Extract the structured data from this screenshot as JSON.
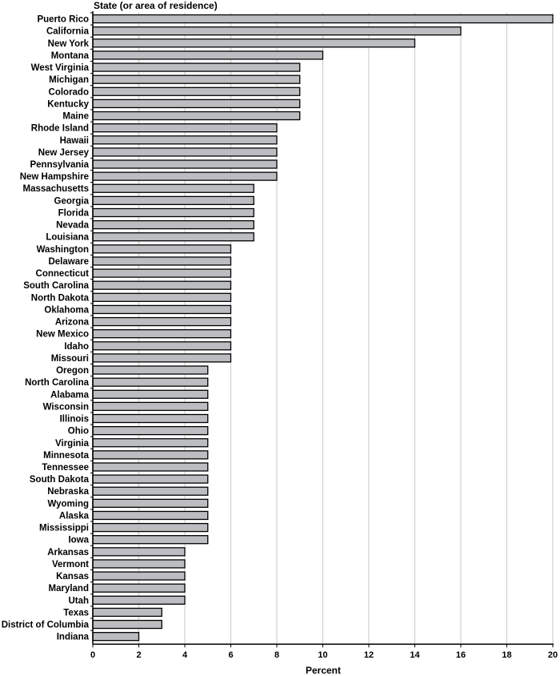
{
  "chart_data": {
    "type": "bar",
    "orientation": "horizontal",
    "title": "",
    "ylabel": "State (or area of residence)",
    "xlabel": "Percent",
    "xlim": [
      0,
      20
    ],
    "xticks": [
      0,
      2,
      4,
      6,
      8,
      10,
      12,
      14,
      16,
      18,
      20
    ],
    "grid": true,
    "bar_color": "#bcbdc0",
    "categories": [
      "Puerto Rico",
      "California",
      "New York",
      "Montana",
      "West Virginia",
      "Michigan",
      "Colorado",
      "Kentucky",
      "Maine",
      "Rhode Island",
      "Hawaii",
      "New Jersey",
      "Pennsylvania",
      "New Hampshire",
      "Massachusetts",
      "Georgia",
      "Florida",
      "Nevada",
      "Louisiana",
      "Washington",
      "Delaware",
      "Connecticut",
      "South Carolina",
      "North Dakota",
      "Oklahoma",
      "Arizona",
      "New Mexico",
      "Idaho",
      "Missouri",
      "Oregon",
      "North Carolina",
      "Alabama",
      "Wisconsin",
      "Illinois",
      "Ohio",
      "Virginia",
      "Minnesota",
      "Tennessee",
      "South Dakota",
      "Nebraska",
      "Wyoming",
      "Alaska",
      "Mississippi",
      "Iowa",
      "Arkansas",
      "Vermont",
      "Kansas",
      "Maryland",
      "Utah",
      "Texas",
      "District of Columbia",
      "Indiana"
    ],
    "values": [
      20,
      16,
      14,
      10,
      9,
      9,
      9,
      9,
      9,
      8,
      8,
      8,
      8,
      8,
      7,
      7,
      7,
      7,
      7,
      6,
      6,
      6,
      6,
      6,
      6,
      6,
      6,
      6,
      6,
      5,
      5,
      5,
      5,
      5,
      5,
      5,
      5,
      5,
      5,
      5,
      5,
      5,
      5,
      5,
      4,
      4,
      4,
      4,
      4,
      3,
      3,
      2
    ]
  }
}
